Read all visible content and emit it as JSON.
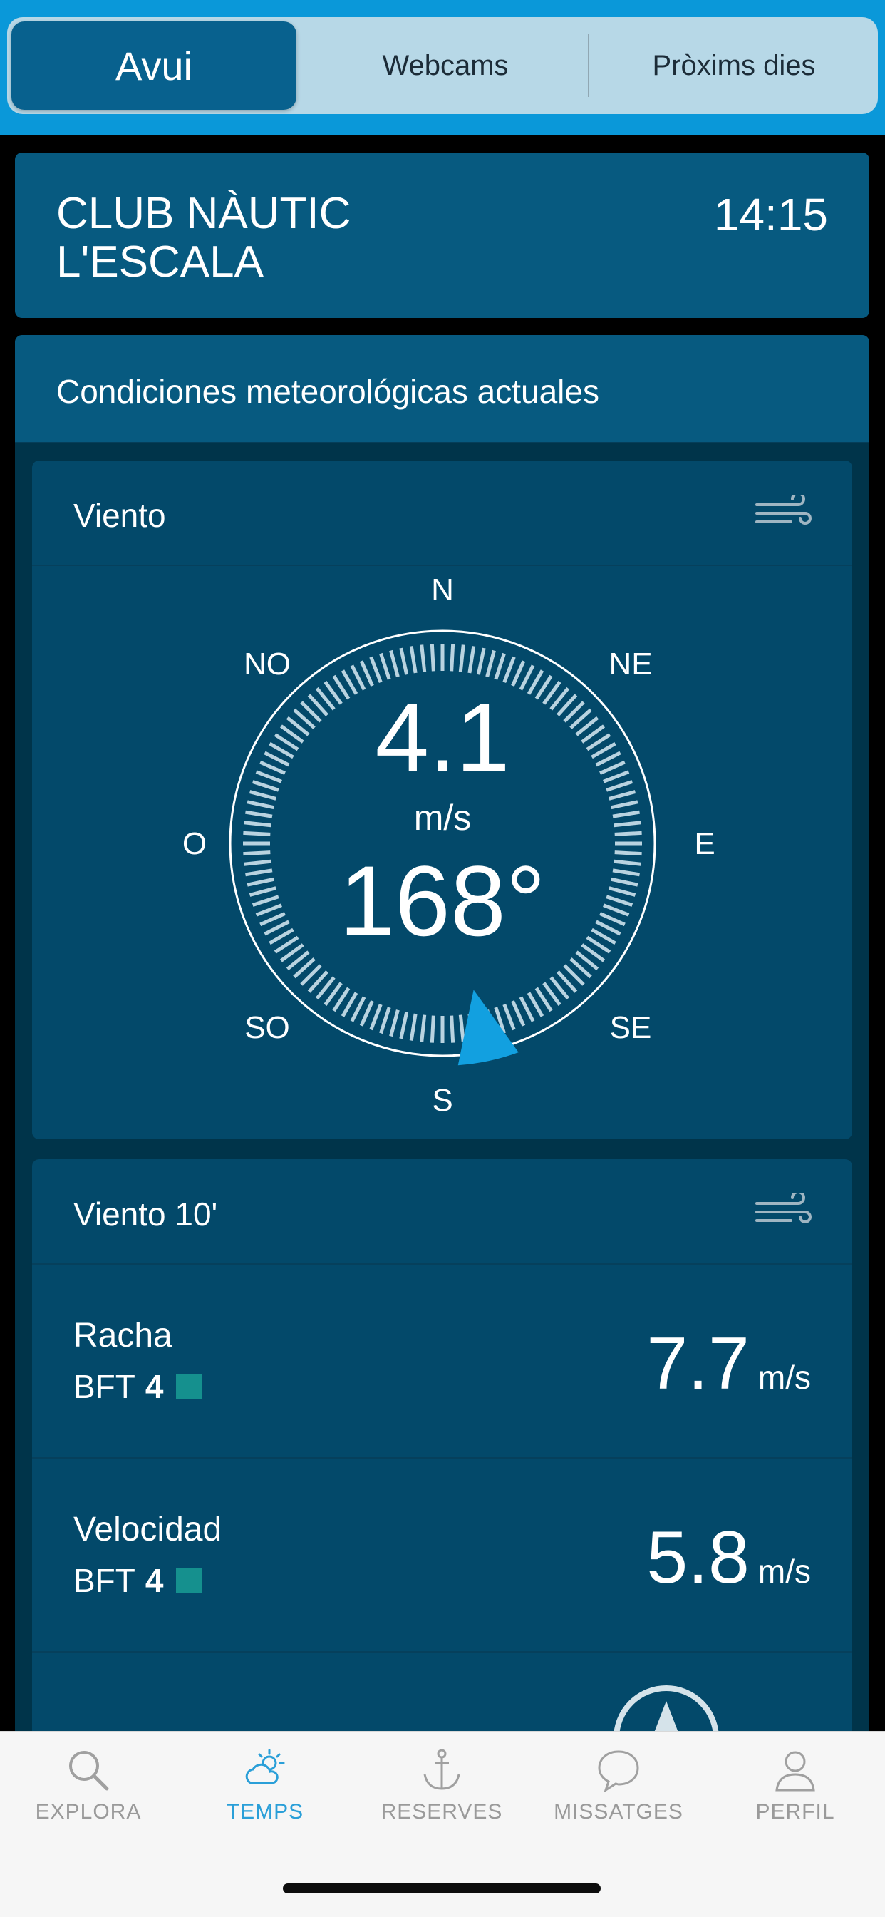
{
  "segmented": {
    "tabs": [
      "Avui",
      "Webcams",
      "Pròxims dies"
    ],
    "active_index": 0
  },
  "station": {
    "name": "CLUB NÀUTIC\nL'ESCALA",
    "time": "14:15"
  },
  "conditions": {
    "title": "Condiciones meteorológicas actuales"
  },
  "wind": {
    "title": "Viento",
    "icon": "wind-icon",
    "speed": "4.1",
    "unit": "m/s",
    "direction": "168°",
    "direction_degrees": 168,
    "cardinals": {
      "n": "N",
      "ne": "NE",
      "e": "E",
      "se": "SE",
      "s": "S",
      "so": "SO",
      "o": "O",
      "no": "NO"
    }
  },
  "wind10": {
    "title": "Viento 10'",
    "icon": "wind-icon",
    "rows": [
      {
        "label": "Racha",
        "bft_prefix": "BFT",
        "bft": "4",
        "value": "7.7",
        "unit": "m/s"
      },
      {
        "label": "Velocidad",
        "bft_prefix": "BFT",
        "bft": "4",
        "value": "5.8",
        "unit": "m/s"
      }
    ]
  },
  "tabbar": {
    "items": [
      {
        "label": "EXPLORA",
        "icon": "search-icon"
      },
      {
        "label": "TEMPS",
        "icon": "weather-icon",
        "active": true
      },
      {
        "label": "RESERVES",
        "icon": "anchor-icon"
      },
      {
        "label": "MISSATGES",
        "icon": "chat-bubble-icon"
      },
      {
        "label": "PERFIL",
        "icon": "user-icon"
      }
    ]
  },
  "colors": {
    "accent": "#0a98d9",
    "card": "#03496a",
    "header": "#075a80",
    "bft_level": "#15908e"
  }
}
